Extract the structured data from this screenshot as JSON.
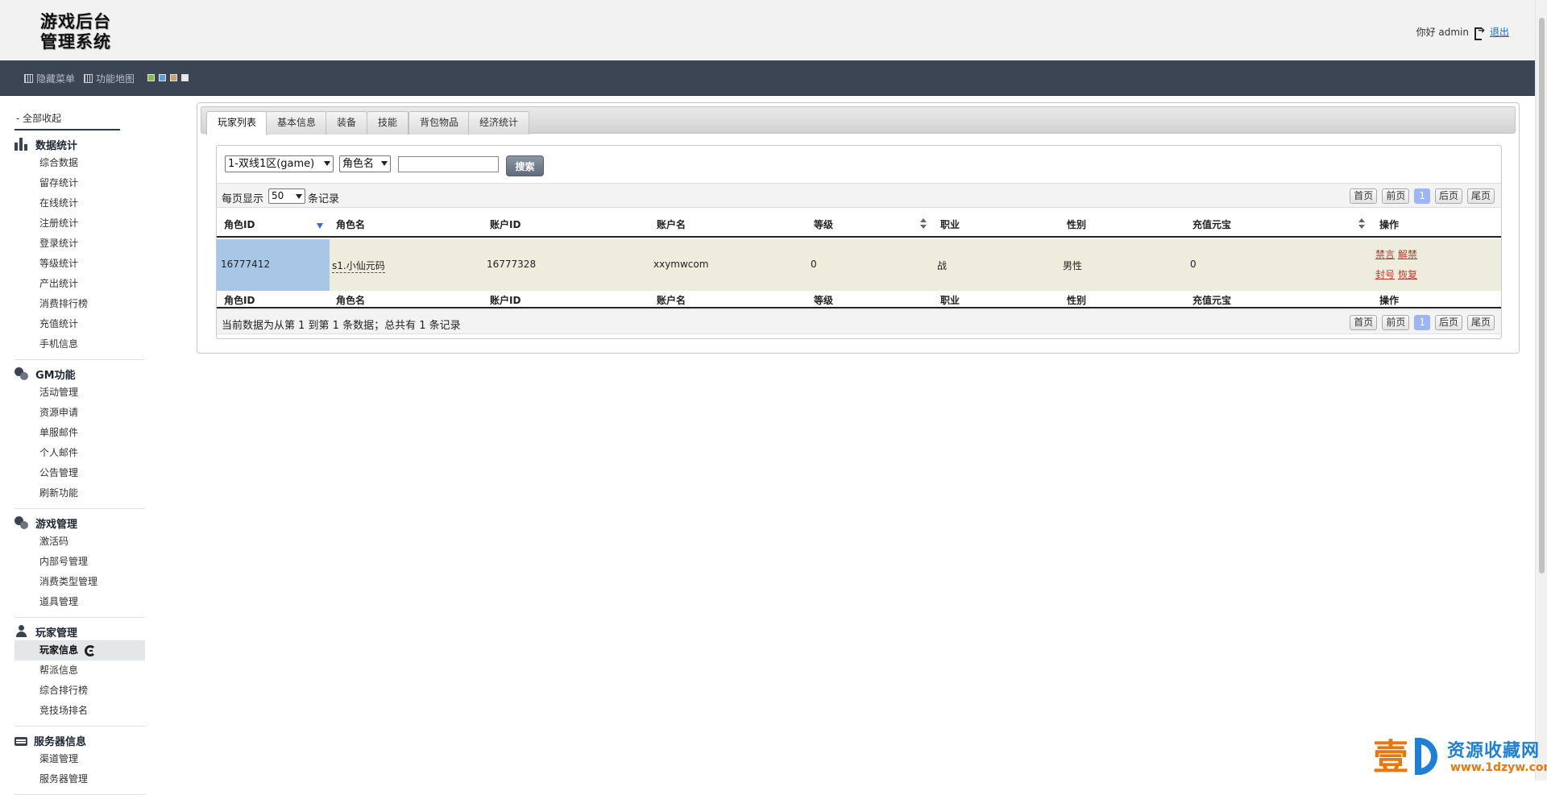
{
  "header": {
    "logo_line1": "游戏后台",
    "logo_line2": "管理系统",
    "greeting": "你好 admin",
    "logout_label": "退出"
  },
  "toolbar": {
    "hide_menu_label": "隐藏菜单",
    "function_map_label": "功能地图",
    "theme_colors": [
      "#7cc243",
      "#5aa0d8",
      "#c9a468",
      "#e8e8e8"
    ]
  },
  "sidebar": {
    "collapse_all_label": "- 全部收起",
    "groups": [
      {
        "title": "数据统计",
        "icon": "bar-chart-icon",
        "items": [
          "综合数据",
          "留存统计",
          "在线统计",
          "注册统计",
          "登录统计",
          "等级统计",
          "产出统计",
          "消费排行榜",
          "充值统计",
          "手机信息"
        ]
      },
      {
        "title": "GM功能",
        "icon": "chat-bubbles-icon",
        "items": [
          "活动管理",
          "资源申请",
          "单服邮件",
          "个人邮件",
          "公告管理",
          "刷新功能"
        ]
      },
      {
        "title": "游戏管理",
        "icon": "chat-bubbles-icon",
        "items": [
          "激活码",
          "内部号管理",
          "消费类型管理",
          "道具管理"
        ]
      },
      {
        "title": "玩家管理",
        "icon": "person-icon",
        "items": [
          "玩家信息",
          "帮派信息",
          "综合排行榜",
          "竞技场排名"
        ],
        "active_item": "玩家信息"
      },
      {
        "title": "服务器信息",
        "icon": "server-icon",
        "items": [
          "渠道管理",
          "服务器管理"
        ]
      }
    ]
  },
  "tabs": [
    "玩家列表",
    "基本信息",
    "装备",
    "技能",
    "背包物品",
    "经济统计"
  ],
  "active_tab": "玩家列表",
  "search": {
    "server_select_value": "1-双线1区(game)",
    "field_select_value": "角色名",
    "query_value": "",
    "search_label": "搜索"
  },
  "list": {
    "per_page_prefix": "每页显示",
    "per_page_value": "50",
    "per_page_suffix": "条记录",
    "pager": {
      "first": "首页",
      "prev": "前页",
      "current": "1",
      "next": "后页",
      "last": "尾页"
    },
    "columns": [
      "角色ID",
      "角色名",
      "账户ID",
      "账户名",
      "等级",
      "职业",
      "性别",
      "充值元宝",
      "操作"
    ],
    "rows": [
      {
        "role_id": "16777412",
        "role_name": "s1.小仙元码",
        "account_id": "16777328",
        "account_name": "xxymwcom",
        "level": "0",
        "job": "战",
        "gender": "男性",
        "recharge": "0",
        "actions": [
          "禁言",
          "解禁",
          "封号",
          "恢复"
        ]
      }
    ],
    "footer_text": "当前数据为从第 1 到第 1 条数据；总共有 1 条记录"
  },
  "watermark": {
    "logo_char": "壹",
    "site_title": "资源收藏网",
    "site_url": "www.1dzyw.com"
  }
}
